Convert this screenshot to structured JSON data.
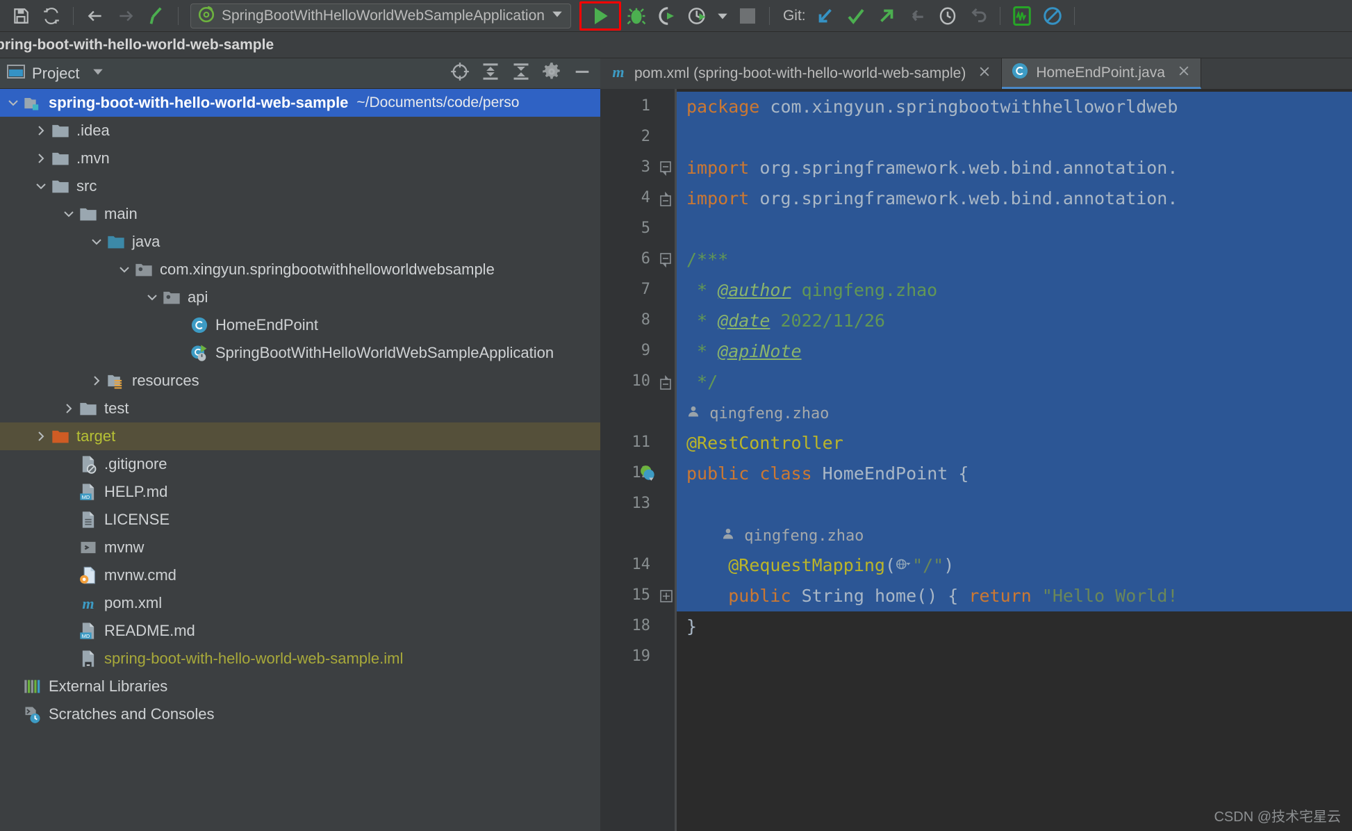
{
  "toolbar": {
    "save_icon": "save-icon",
    "refresh_icon": "sync-icon",
    "back_icon": "back-arrow-icon",
    "forward_icon": "forward-arrow-icon",
    "build_icon": "hammer-icon",
    "run_config_name": "SpringBootWithHelloWorldWebSampleApplication",
    "run_config_icon": "spring-boot-icon",
    "run_config_dropdown_icon": "chevron-down-icon",
    "run_icon": "run-play-icon",
    "debug_icon": "debug-bug-icon",
    "run_coverage_icon": "run-with-coverage-icon",
    "profiler_icon": "profiler-clock-icon",
    "profiler_dropdown_icon": "chevron-down-icon",
    "stop_icon": "stop-square-icon",
    "git_label": "Git:",
    "git_update_icon": "update-project-icon",
    "git_commit_icon": "commit-checkmark-icon",
    "git_push_icon": "push-arrow-icon",
    "git_pull_icon": "pull-arrow-icon",
    "git_history_icon": "history-clock-icon",
    "git_rollback_icon": "rollback-undo-icon",
    "search_everywhere_icon": "activity-monitor-icon",
    "block_icon": "no-entry-icon",
    "run_button_highlight_color": "#ff0000"
  },
  "breadcrumb": {
    "path": "pring-boot-with-hello-world-web-sample"
  },
  "project_panel": {
    "title": "Project",
    "dropdown_icon": "chevron-down-icon",
    "window_icon": "project-window-icon",
    "actions": [
      {
        "name": "select-opened-file-icon",
        "label": "Select Opened File"
      },
      {
        "name": "expand-all-icon",
        "label": "Expand All"
      },
      {
        "name": "collapse-all-icon",
        "label": "Collapse All"
      },
      {
        "name": "gear-icon",
        "label": "Settings"
      },
      {
        "name": "minimize-icon",
        "label": "Hide"
      }
    ],
    "tree": [
      {
        "label": "spring-boot-with-hello-world-web-sample",
        "sub": "~/Documents/code/perso",
        "icon": "module-folder-icon",
        "indent": 0,
        "arrow": "expanded",
        "state": "selected"
      },
      {
        "label": ".idea",
        "sub": "",
        "icon": "folder-icon",
        "indent": 1,
        "arrow": "collapsed",
        "state": "excluded"
      },
      {
        "label": ".mvn",
        "sub": "",
        "icon": "folder-icon",
        "indent": 1,
        "arrow": "collapsed",
        "state": "normal"
      },
      {
        "label": "src",
        "sub": "",
        "icon": "folder-icon",
        "indent": 1,
        "arrow": "expanded",
        "state": "normal"
      },
      {
        "label": "main",
        "sub": "",
        "icon": "folder-icon",
        "indent": 2,
        "arrow": "expanded",
        "state": "normal"
      },
      {
        "label": "java",
        "sub": "",
        "icon": "source-folder-icon",
        "indent": 3,
        "arrow": "expanded",
        "state": "normal"
      },
      {
        "label": "com.xingyun.springbootwithhelloworldwebsample",
        "sub": "",
        "icon": "package-icon",
        "indent": 4,
        "arrow": "expanded",
        "state": "normal"
      },
      {
        "label": "api",
        "sub": "",
        "icon": "package-icon",
        "indent": 5,
        "arrow": "expanded",
        "state": "normal"
      },
      {
        "label": "HomeEndPoint",
        "sub": "",
        "icon": "java-class-icon",
        "indent": 6,
        "arrow": "none",
        "state": "normal"
      },
      {
        "label": "SpringBootWithHelloWorldWebSampleApplication",
        "sub": "",
        "icon": "spring-boot-class-icon",
        "indent": 6,
        "arrow": "none",
        "state": "normal"
      },
      {
        "label": "resources",
        "sub": "",
        "icon": "resources-folder-icon",
        "indent": 3,
        "arrow": "collapsed",
        "state": "normal"
      },
      {
        "label": "test",
        "sub": "",
        "icon": "folder-icon",
        "indent": 2,
        "arrow": "collapsed",
        "state": "normal"
      },
      {
        "label": "target",
        "sub": "",
        "icon": "excluded-folder-icon",
        "indent": 1,
        "arrow": "collapsed",
        "state": "marked"
      },
      {
        "label": ".gitignore",
        "sub": "",
        "icon": "gitignore-file-icon",
        "indent": 2,
        "arrow": "none",
        "state": "normal"
      },
      {
        "label": "HELP.md",
        "sub": "",
        "icon": "markdown-file-icon",
        "indent": 2,
        "arrow": "none",
        "state": "normal"
      },
      {
        "label": "LICENSE",
        "sub": "",
        "icon": "text-file-icon",
        "indent": 2,
        "arrow": "none",
        "state": "normal"
      },
      {
        "label": "mvnw",
        "sub": "",
        "icon": "shell-script-icon",
        "indent": 2,
        "arrow": "none",
        "state": "normal"
      },
      {
        "label": "mvnw.cmd",
        "sub": "",
        "icon": "cmd-script-icon",
        "indent": 2,
        "arrow": "none",
        "state": "normal"
      },
      {
        "label": "pom.xml",
        "sub": "",
        "icon": "maven-pom-icon",
        "indent": 2,
        "arrow": "none",
        "state": "normal"
      },
      {
        "label": "README.md",
        "sub": "",
        "icon": "markdown-file-icon",
        "indent": 2,
        "arrow": "none",
        "state": "normal"
      },
      {
        "label": "spring-boot-with-hello-world-web-sample.iml",
        "sub": "",
        "icon": "iml-file-icon",
        "indent": 2,
        "arrow": "none",
        "state": "yellow"
      },
      {
        "label": "External Libraries",
        "sub": "",
        "icon": "external-libraries-icon",
        "indent": 0,
        "arrow": "none",
        "state": "normal"
      },
      {
        "label": "Scratches and Consoles",
        "sub": "",
        "icon": "scratches-icon",
        "indent": 0,
        "arrow": "none",
        "state": "normal"
      }
    ]
  },
  "editor": {
    "tabs": [
      {
        "label": "pom.xml (spring-boot-with-hello-world-web-sample)",
        "icon": "maven-pom-icon",
        "active": false,
        "close_icon": "close-icon"
      },
      {
        "label": "HomeEndPoint.java",
        "icon": "java-class-icon",
        "active": true,
        "close_icon": "close-icon"
      }
    ],
    "line_numbers": [
      "1",
      "2",
      "3",
      "4",
      "5",
      "6",
      "7",
      "8",
      "9",
      "10",
      "11",
      "12",
      "13",
      "14",
      "15",
      "18",
      "19"
    ],
    "gutter_markers": [
      {
        "line": "12",
        "icon": "spring-bean-gutter-icon"
      },
      {
        "line": "15",
        "icon": "expand-plus-icon"
      }
    ],
    "code_lines": [
      {
        "n": "1",
        "selected": true,
        "fold": "none",
        "tokens": [
          {
            "t": "kw",
            "v": "package"
          },
          {
            "t": "txt",
            "v": " com.xingyun.springbootwithhelloworldweb"
          }
        ]
      },
      {
        "n": "2",
        "selected": true,
        "fold": "none",
        "tokens": []
      },
      {
        "n": "3",
        "selected": true,
        "fold": "collapse",
        "tokens": [
          {
            "t": "kw",
            "v": "import"
          },
          {
            "t": "txt",
            "v": " org.springframework.web.bind.annotation."
          }
        ]
      },
      {
        "n": "4",
        "selected": true,
        "fold": "collapse2",
        "tokens": [
          {
            "t": "kw",
            "v": "import"
          },
          {
            "t": "txt",
            "v": " org.springframework.web.bind.annotation."
          }
        ]
      },
      {
        "n": "5",
        "selected": true,
        "fold": "none",
        "tokens": []
      },
      {
        "n": "6",
        "selected": true,
        "fold": "collapse",
        "tokens": [
          {
            "t": "cmt",
            "v": "/***"
          }
        ]
      },
      {
        "n": "7",
        "selected": true,
        "fold": "none",
        "tokens": [
          {
            "t": "cmt",
            "v": " * "
          },
          {
            "t": "cmt-tag",
            "v": "@author"
          },
          {
            "t": "cmt",
            "v": " qingfeng.zhao"
          }
        ]
      },
      {
        "n": "8",
        "selected": true,
        "fold": "none",
        "tokens": [
          {
            "t": "cmt",
            "v": " * "
          },
          {
            "t": "cmt-tag",
            "v": "@date"
          },
          {
            "t": "cmt",
            "v": " 2022/11/26"
          }
        ]
      },
      {
        "n": "9",
        "selected": true,
        "fold": "none",
        "tokens": [
          {
            "t": "cmt",
            "v": " * "
          },
          {
            "t": "cmt-tag",
            "v": "@apiNote"
          }
        ]
      },
      {
        "n": "10",
        "selected": true,
        "fold": "collapse2",
        "tokens": [
          {
            "t": "cmt",
            "v": " */"
          }
        ]
      },
      {
        "n": "",
        "selected": true,
        "fold": "none",
        "hint": "qingfeng.zhao",
        "hint_icon": "author-avatar-icon",
        "tokens": []
      },
      {
        "n": "11",
        "selected": true,
        "fold": "none",
        "tokens": [
          {
            "t": "ann",
            "v": "@RestController"
          }
        ]
      },
      {
        "n": "12",
        "selected": true,
        "fold": "none",
        "tokens": [
          {
            "t": "kw",
            "v": "public class"
          },
          {
            "t": "txt",
            "v": " HomeEndPoint {"
          }
        ]
      },
      {
        "n": "13",
        "selected": true,
        "fold": "none",
        "tokens": []
      },
      {
        "n": "",
        "selected": true,
        "fold": "none",
        "hint": "qingfeng.zhao",
        "hint_icon": "author-avatar-icon",
        "indent": 1,
        "tokens": []
      },
      {
        "n": "14",
        "selected": true,
        "fold": "none",
        "tokens": [
          {
            "t": "txt",
            "v": "    "
          },
          {
            "t": "ann",
            "v": "@RequestMapping"
          },
          {
            "t": "txt",
            "v": "("
          },
          {
            "t": "ico",
            "v": "url-mapping-icon"
          },
          {
            "t": "str",
            "v": "\"/\""
          },
          {
            "t": "txt",
            "v": ")"
          }
        ]
      },
      {
        "n": "15",
        "selected": true,
        "fold": "expand",
        "tokens": [
          {
            "t": "txt",
            "v": "    "
          },
          {
            "t": "kw",
            "v": "public"
          },
          {
            "t": "txt",
            "v": " String home"
          },
          {
            "t": "txt",
            "v": "() { "
          },
          {
            "t": "kw",
            "v": "return"
          },
          {
            "t": "txt",
            "v": " "
          },
          {
            "t": "str",
            "v": "\"Hello World!"
          }
        ]
      },
      {
        "n": "18",
        "selected": false,
        "fold": "none",
        "tokens": [
          {
            "t": "txt",
            "v": "}"
          }
        ]
      },
      {
        "n": "19",
        "selected": false,
        "fold": "none",
        "tokens": []
      }
    ]
  },
  "watermark": "CSDN @技术宅星云",
  "colors": {
    "selection_blue": "#2c5695",
    "toolbar_bg": "#3c3f41",
    "editor_bg": "#2b2b2b",
    "gutter_bg": "#313335",
    "tree_selected": "#2f62c4",
    "tree_marked": "#55503a",
    "keyword_orange": "#cc7832",
    "comment_green": "#629755",
    "annotation_yellow": "#bbb529",
    "string_green": "#6a8759",
    "text_grey": "#a9b7c6"
  }
}
